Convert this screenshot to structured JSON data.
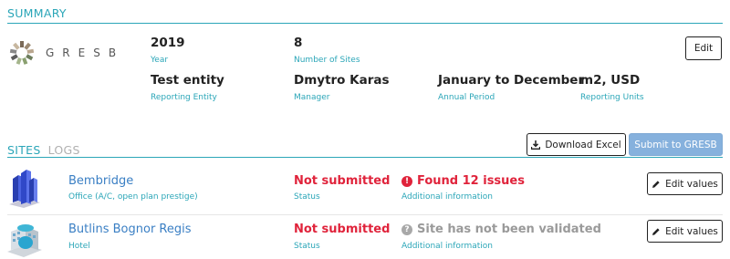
{
  "summary": {
    "title": "SUMMARY",
    "logo_text": "GRESB",
    "year": {
      "value": "2019",
      "label": "Year"
    },
    "sites_count": {
      "value": "8",
      "label": "Number of Sites"
    },
    "entity": {
      "value": "Test entity",
      "label": "Reporting Entity"
    },
    "manager": {
      "value": "Dmytro Karas",
      "label": "Manager"
    },
    "period": {
      "value": "January to December",
      "label": "Annual Period"
    },
    "units": {
      "value": "m2, USD",
      "label": "Reporting Units"
    },
    "edit_label": "Edit"
  },
  "tabs": {
    "sites": "SITES",
    "logs": "LOGS"
  },
  "actions": {
    "download_label": "Download Excel",
    "submit_label": "Submit to GRESB"
  },
  "colors": {
    "accent": "#2ba6b8",
    "link": "#3a7fc4",
    "error": "#e0233b",
    "muted": "#9a9a9a",
    "primary_button": "#86b1dd"
  },
  "sites": [
    {
      "name": "Bembridge",
      "type": "Office (A/C, open plan prestige)",
      "status": "Not submitted",
      "status_label": "Status",
      "info": "Found 12 issues",
      "info_icon": "exclamation-circle-icon",
      "info_label": "Additional information",
      "edit_label": "Edit values"
    },
    {
      "name": "Butlins Bognor Regis",
      "type": "Hotel",
      "status": "Not submitted",
      "status_label": "Status",
      "info": "Site has not been validated",
      "info_icon": "question-circle-icon",
      "info_label": "Additional information",
      "edit_label": "Edit values"
    }
  ]
}
